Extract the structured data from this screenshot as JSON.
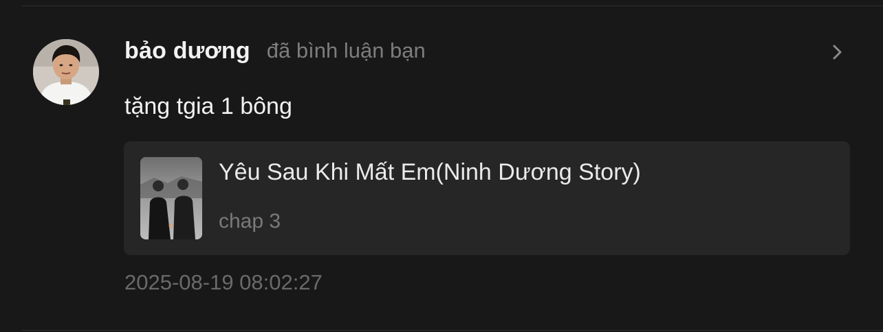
{
  "notification": {
    "user_name": "bảo dương",
    "action_text": "đã bình luận bạn",
    "comment_text": "tặng tgia 1 bông",
    "timestamp": "2025-08-19 08:02:27",
    "avatar_icon": "user-avatar",
    "chevron_icon": "chevron-right-icon"
  },
  "story": {
    "title": "Yêu Sau Khi Mất Em(Ninh Dương Story)",
    "chapter": "chap 3",
    "cover_icon": "story-cover-image"
  }
}
